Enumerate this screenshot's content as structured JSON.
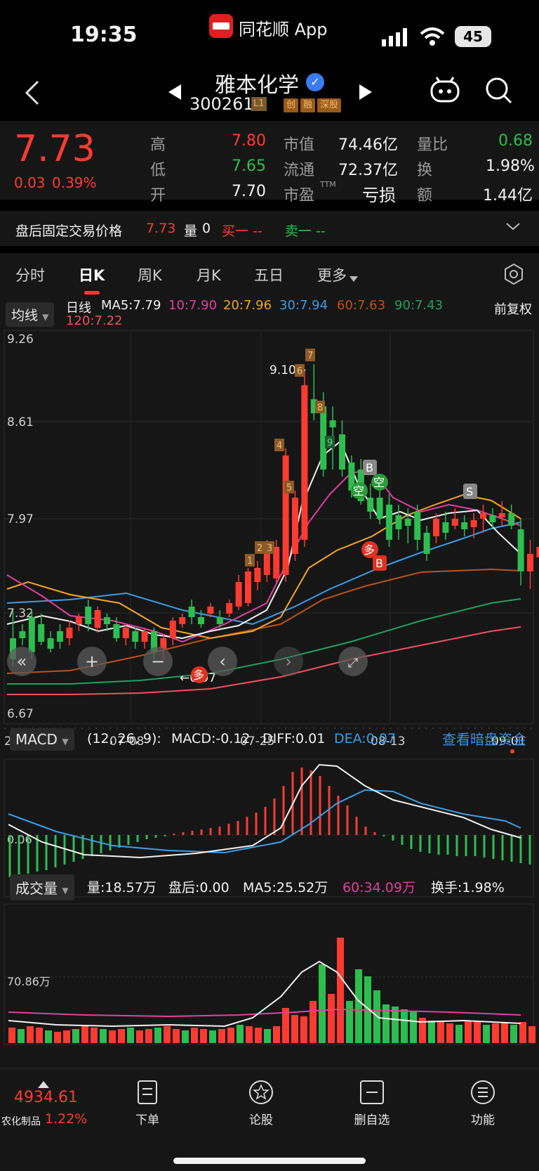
{
  "status": {
    "time": "19:35",
    "app": "同花顺 App",
    "battery": "45"
  },
  "nav": {
    "title": "雅本化学",
    "code": "300261",
    "level": "L1",
    "badges": [
      "创",
      "融",
      "深股"
    ]
  },
  "quote": {
    "price": "7.73",
    "change": "0.03",
    "change_pct": "0.39%",
    "high_label": "高",
    "high": "7.80",
    "low_label": "低",
    "low": "7.65",
    "open_label": "开",
    "open": "7.70",
    "mcap_label": "市值",
    "mcap": "74.46亿",
    "float_label": "流通",
    "float": "72.37亿",
    "pe_label": "市盈",
    "pe_sup": "TTM",
    "pe": "亏损",
    "vr_label": "量比",
    "vr": "0.68",
    "turn_label": "换",
    "turn": "1.98%",
    "amount_label": "额",
    "amount": "1.44亿"
  },
  "after_hours": {
    "label": "盘后固定交易价格",
    "price": "7.73",
    "vol_label": "量",
    "vol": "0",
    "buy": "买一 --",
    "sell": "卖一 --"
  },
  "tabs": [
    "分时",
    "日K",
    "周K",
    "月K",
    "五日",
    "更多"
  ],
  "active_tab": "日K",
  "ma_bar": {
    "selector": "均线",
    "period": "日线",
    "ma5": "MA5:7.79",
    "ma10": "10:7.90",
    "ma20": "20:7.96",
    "ma30": "30:7.94",
    "ma60": "60:7.63",
    "ma90": "90:7.43",
    "ma120": "120:7.22",
    "adjust": "前复权"
  },
  "price_axis": [
    "9.26",
    "8.61",
    "7.97",
    "7.32",
    "6.67"
  ],
  "annotations": {
    "max": "9.10→",
    "min": "←6.97"
  },
  "date_axis": [
    "2025-06-20",
    "07-08",
    "07-25",
    "08-13",
    "09-01"
  ],
  "macd": {
    "selector": "MACD",
    "params": "(12, 26, 9):",
    "macd": "MACD:-0.12",
    "diff": "DIFF:0.01",
    "dea": "DEA:0.07",
    "link": "查看暗盘资金",
    "axis": "0.06"
  },
  "volume": {
    "selector": "成交量",
    "vol": "量:18.57万",
    "after": "盘后:0.00",
    "ma5": "MA5:25.52万",
    "ma60": "60:34.09万",
    "turnover": "换手:1.98%",
    "axis": "70.86万"
  },
  "markers": {
    "n1": "1",
    "n2": "2",
    "n3": "3",
    "n4": "4",
    "n5": "5",
    "n6": "6",
    "n7": "7",
    "n8": "8",
    "n9": "9",
    "b": "B",
    "s": "S",
    "kong": "空",
    "duo": "多"
  },
  "bottom": {
    "index_value": "4934.61",
    "index_name": "农化制品",
    "index_pct": "1.22%",
    "items": [
      "下单",
      "论股",
      "删自选",
      "功能"
    ]
  },
  "colors": {
    "up": "#ff3b30",
    "down": "#2dbe4f",
    "ma5": "#f0f0f0",
    "ma10": "#e040a0",
    "ma20": "#f5a623",
    "ma30": "#3a9ee8",
    "ma60": "#c0501a",
    "ma90": "#1fa060",
    "ma120": "#f05060",
    "accent": "#3a8ee6"
  }
}
